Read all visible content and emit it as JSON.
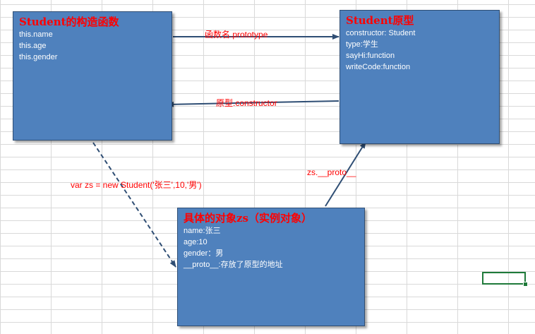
{
  "constructor_box": {
    "title": "Student的构造函数",
    "lines": [
      "this.name",
      "this.age",
      "this.gender"
    ]
  },
  "prototype_box": {
    "title": "Student原型",
    "lines": [
      "constructor:  Student",
      "type:学生",
      "sayHi:function",
      "writeCode:function"
    ]
  },
  "instance_box": {
    "title": "具体的对象zs（实例对象）",
    "lines": [
      "name:张三",
      "age:10",
      "gender：男",
      "__proto__:存放了原型的地址"
    ]
  },
  "edges": {
    "prototype_label": "函数名.prototype",
    "constructor_label": "原型.constructor",
    "new_label": "var zs = new Student('张三',10,'男')",
    "proto_label": "zs.__proto__"
  },
  "colors": {
    "box_fill": "#4f81bd",
    "arrow": "#2f4e74",
    "label": "#ff0000"
  }
}
